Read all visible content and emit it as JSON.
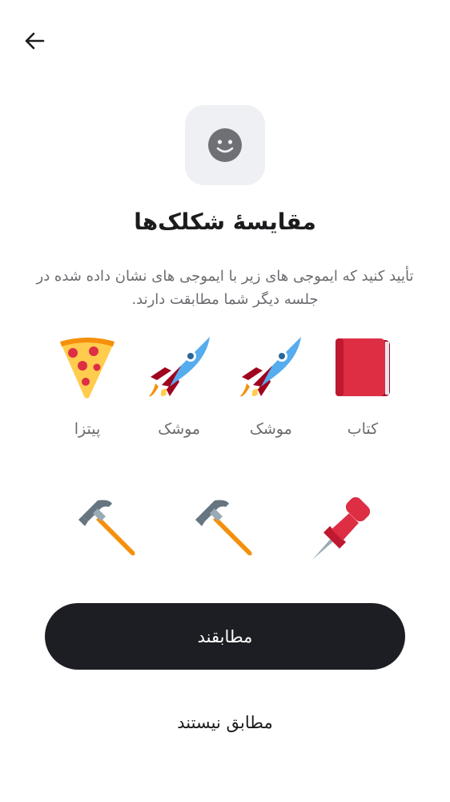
{
  "header": {
    "back_icon": "arrow-left-icon",
    "badge_icon": "smiley-face-icon"
  },
  "title": "مقایسهٔ شکلک‌ها",
  "description": "تأیید کنید که ایموجی های زیر با ایموجی های نشان داده شده در جلسه دیگر شما مطابقت دارند.",
  "emojis_row1": [
    {
      "icon": "book-icon",
      "label": "کتاب"
    },
    {
      "icon": "rocket-icon",
      "label": "موشک"
    },
    {
      "icon": "rocket-icon",
      "label": "موشک"
    },
    {
      "icon": "pizza-icon",
      "label": "پیتزا"
    }
  ],
  "emojis_row2": [
    {
      "icon": "pushpin-icon"
    },
    {
      "icon": "hammer-icon"
    },
    {
      "icon": "hammer-icon"
    }
  ],
  "actions": {
    "match_label": "مطابقند",
    "no_match_label": "مطابق نیستند"
  },
  "colors": {
    "primary_button": "#1d1e23",
    "icon_box": "#eff0f3",
    "muted_text": "#6b6c70"
  }
}
